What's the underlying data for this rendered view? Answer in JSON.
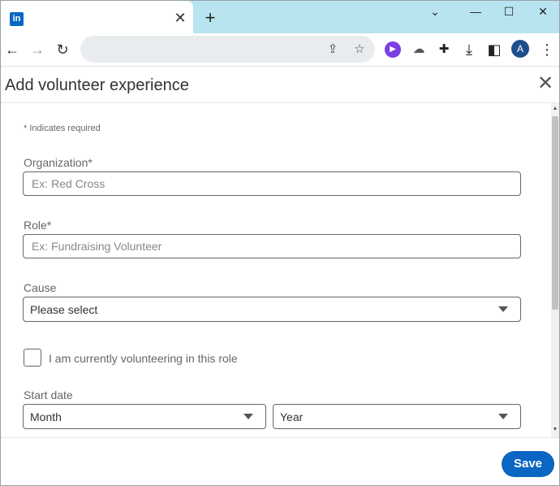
{
  "browser": {
    "tab": {
      "favicon_text": "in",
      "close_glyph": "✕"
    },
    "new_tab_glyph": "+",
    "window_controls": {
      "chevron": "⌄",
      "minimize": "—",
      "maximize": "☐",
      "close": "✕"
    },
    "nav": {
      "back": "←",
      "forward": "→",
      "reload": "↻"
    },
    "omnibox": {
      "value": "",
      "share_glyph": "⇪",
      "star_glyph": "☆"
    },
    "extensions": {
      "play_glyph": "▶",
      "cloud_glyph": "☁",
      "puzzle_glyph": "✚",
      "download_glyph": "⤓",
      "sidebar_glyph": "◧"
    },
    "avatar_initial": "A",
    "menu_glyph": "⋮"
  },
  "modal": {
    "title": "Add volunteer experience",
    "close_glyph": "✕",
    "required_note": "* Indicates required",
    "organization": {
      "label": "Organization*",
      "placeholder": "Ex: Red Cross",
      "value": ""
    },
    "role": {
      "label": "Role*",
      "placeholder": "Ex: Fundraising Volunteer",
      "value": ""
    },
    "cause": {
      "label": "Cause",
      "selected": "Please select"
    },
    "currently_volunteering": {
      "label": "I am currently volunteering in this role",
      "checked": false
    },
    "start_date": {
      "label": "Start date",
      "month": "Month",
      "year": "Year"
    },
    "save_label": "Save"
  },
  "colors": {
    "accent": "#0a66c2",
    "tab_strip": "#b8e4ef",
    "avatar": "#1f4e8c",
    "extension": "#7b3fe4"
  }
}
